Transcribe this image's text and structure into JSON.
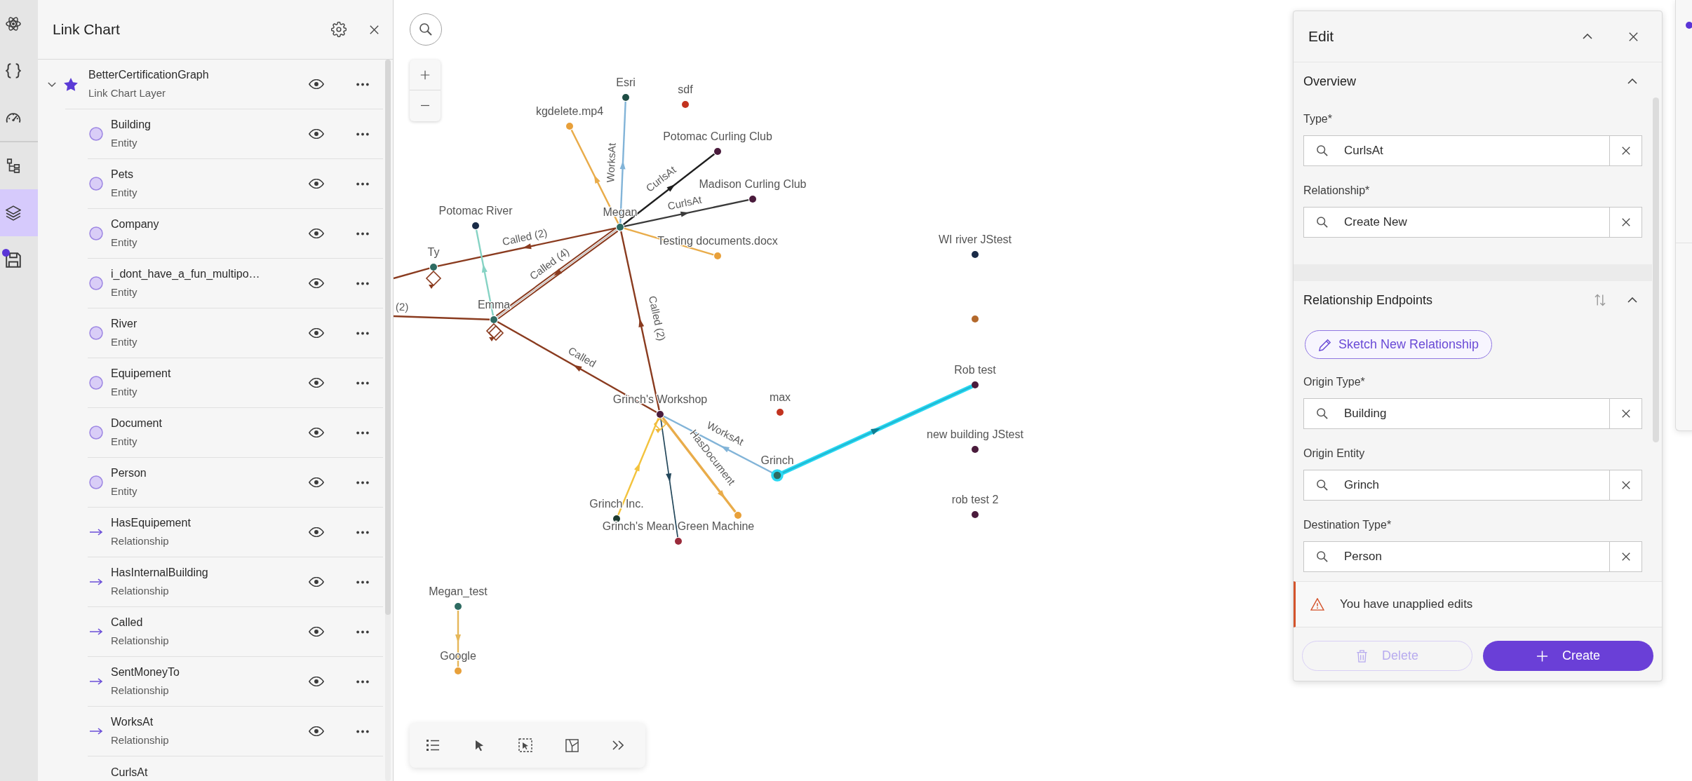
{
  "rail": {
    "groups": [
      {
        "items": [
          {
            "selected": false,
            "badge": false
          },
          {
            "selected": false,
            "badge": false
          },
          {
            "selected": false,
            "badge": false
          }
        ]
      },
      {
        "items": [
          {
            "selected": false,
            "badge": false
          },
          {
            "selected": true,
            "badge": false
          },
          {
            "selected": false,
            "badge": true
          }
        ]
      }
    ]
  },
  "layers_panel": {
    "title": "Link Chart",
    "layer": {
      "name": "BetterCertificationGraph",
      "subtitle": "Link Chart Layer",
      "expanded": true,
      "visible": true,
      "children": [
        {
          "name": "Building",
          "type": "Entity",
          "kind": "entity",
          "visible": true
        },
        {
          "name": "Pets",
          "type": "Entity",
          "kind": "entity",
          "visible": true
        },
        {
          "name": "Company",
          "type": "Entity",
          "kind": "entity",
          "visible": true
        },
        {
          "name": "i_dont_have_a_fun_multipo…",
          "type": "Entity",
          "kind": "entity",
          "visible": true
        },
        {
          "name": "River",
          "type": "Entity",
          "kind": "entity",
          "visible": true
        },
        {
          "name": "Equipement",
          "type": "Entity",
          "kind": "entity",
          "visible": true
        },
        {
          "name": "Document",
          "type": "Entity",
          "kind": "entity",
          "visible": true
        },
        {
          "name": "Person",
          "type": "Entity",
          "kind": "entity",
          "visible": true
        },
        {
          "name": "HasEquipement",
          "type": "Relationship",
          "kind": "relationship",
          "visible": true
        },
        {
          "name": "HasInternalBuilding",
          "type": "Relationship",
          "kind": "relationship",
          "visible": true
        },
        {
          "name": "Called",
          "type": "Relationship",
          "kind": "relationship",
          "visible": true
        },
        {
          "name": "SentMoneyTo",
          "type": "Relationship",
          "kind": "relationship",
          "visible": true
        },
        {
          "name": "WorksAt",
          "type": "Relationship",
          "kind": "relationship",
          "visible": true
        },
        {
          "name": "CurlsAt"
        }
      ]
    }
  },
  "graph": {
    "nodes": [
      {
        "label": "Esri",
        "color": "#1f4d45",
        "selected": false
      },
      {
        "label": "sdf",
        "color": "#c2331f",
        "selected": false
      },
      {
        "label": "kgdelete.mp4",
        "color": "#e8a03a",
        "selected": false
      },
      {
        "label": "Potomac Curling Club",
        "color": "#4a1b3c",
        "selected": false
      },
      {
        "label": "Madison Curling Club",
        "color": "#4a1b3c",
        "selected": false
      },
      {
        "label": "Megan",
        "color": "#2e6b62",
        "selected": false
      },
      {
        "label": "Potomac River",
        "color": "#1a2b47",
        "selected": false
      },
      {
        "label": "Testing documents.docx",
        "color": "#e8a03a",
        "selected": false
      },
      {
        "label": "Ty",
        "color": "#2e6b62",
        "selected": false
      },
      {
        "label": "Emma",
        "color": "#2e6b62",
        "selected": false
      },
      {
        "label": "WI river JStest",
        "color": "#1a2b47",
        "selected": false
      },
      {
        "color": "#b3692c",
        "selected": false
      },
      {
        "label": "Rob test",
        "color": "#4a1b3c",
        "selected": false
      },
      {
        "label": "Grinch's Workshop",
        "color": "#4a1b3c",
        "selected": false
      },
      {
        "label": "max",
        "color": "#c2331f",
        "selected": false
      },
      {
        "label": "new building JStest",
        "color": "#4a1b3c",
        "selected": false
      },
      {
        "label": "Grinch",
        "color": "#2e6b62",
        "selected": true
      },
      {
        "label": "rob test 2",
        "color": "#4a1b3c",
        "selected": false
      },
      {
        "label": "Grinch Inc.",
        "color": "#1c3a30",
        "selected": false
      },
      {
        "color": "#e8a03a",
        "selected": false
      },
      {
        "label": "Grinch's Mean Green Machine",
        "color": "#9a2b3b",
        "selected": false
      },
      {
        "label": "Megan_test",
        "color": "#2e6b62",
        "selected": false
      },
      {
        "label": "Google",
        "color": "#e8a03a",
        "selected": false
      }
    ],
    "edges": [
      {
        "kind": "link",
        "label": "WorksAt",
        "color": "#82b4d8",
        "selected": false
      },
      {
        "kind": "link",
        "color": "#e9ac4a",
        "selected": false
      },
      {
        "kind": "link",
        "label": "CurlsAt",
        "color": "#1e1e1e",
        "selected": false
      },
      {
        "kind": "link",
        "label": "CurlsAt",
        "color": "#3a3a3a",
        "selected": false
      },
      {
        "kind": "link",
        "color": "#e9ac4a",
        "selected": false
      },
      {
        "kind": "link",
        "label": "Called (2)",
        "color": "#8a3b1f",
        "selected": false
      },
      {
        "kind": "link",
        "label": "Called (4)",
        "color": "#8a3b1f",
        "selected": false
      },
      {
        "kind": "link",
        "color": "#86d3c4",
        "selected": false
      },
      {
        "kind": "link",
        "color": "#8a3b1f",
        "selected": false
      },
      {
        "kind": "link",
        "label": "(2)",
        "color": "#8a3b1f",
        "selected": false
      },
      {
        "kind": "link",
        "label": "Called",
        "color": "#8a3b1f",
        "selected": false
      },
      {
        "kind": "link",
        "label": "Called (2)",
        "color": "#8a3b1f",
        "selected": false
      },
      {
        "kind": "link",
        "label": "WorksAt",
        "color": "#82b4d8",
        "selected": false
      },
      {
        "kind": "link",
        "label": "HasDocument",
        "color": "#e9ac4a",
        "selected": false
      },
      {
        "kind": "link",
        "color": "#f3c33d",
        "selected": false
      },
      {
        "kind": "link",
        "color": "#24485c",
        "selected": false
      },
      {
        "kind": "link",
        "color": "#1fb8d3",
        "selected": true
      },
      {
        "kind": "link",
        "color": "#e6b75a",
        "selected": false
      },
      {
        "kind": "loop",
        "color": "#8a3b1f",
        "selected": false
      },
      {
        "kind": "loop",
        "color": "#8a3b1f",
        "selected": false
      },
      {
        "kind": "loop",
        "color": "#f0b93a",
        "selected": false
      }
    ]
  },
  "edit_panel": {
    "title": "Edit",
    "sections": [
      {
        "kind": "overview",
        "title": "Overview",
        "expanded": true,
        "fields": [
          {
            "label": "Type*",
            "value": "CurlsAt"
          },
          {
            "label": "Relationship*",
            "value": "Create New"
          }
        ]
      },
      {
        "kind": "endpoints",
        "title": "Relationship Endpoints",
        "expanded": true,
        "sketch_button": "Sketch New Relationship",
        "fields": [
          {
            "label": "Origin Type*",
            "value": "Building"
          },
          {
            "label": "Origin Entity",
            "value": "Grinch"
          },
          {
            "label": "Destination Type*",
            "value": "Person"
          }
        ]
      }
    ],
    "warning": "You have unapplied edits",
    "buttons": [
      {
        "kind": "delete",
        "label": "Delete",
        "disabled": true
      },
      {
        "kind": "create",
        "label": "Create",
        "disabled": false
      }
    ]
  }
}
